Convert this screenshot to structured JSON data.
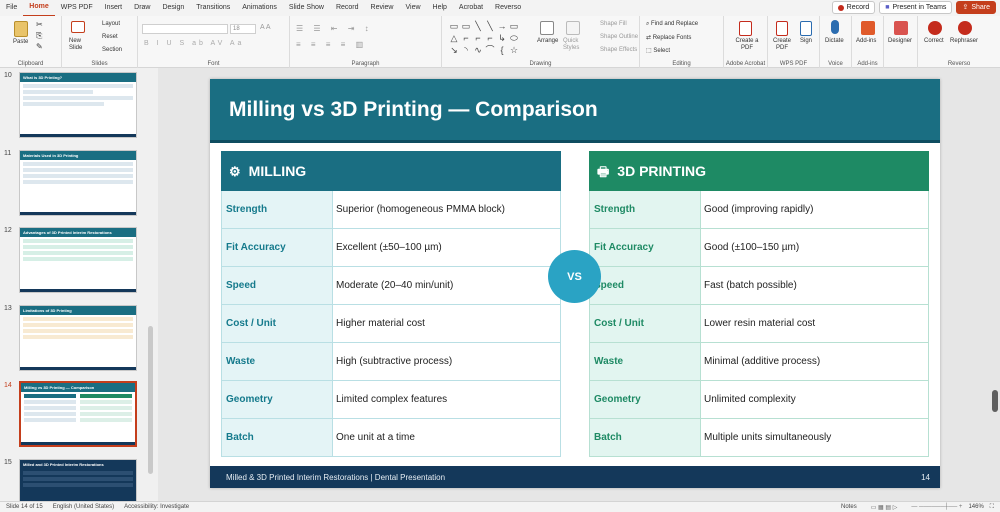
{
  "menubar": {
    "items": [
      "File",
      "Home",
      "WPS PDF",
      "Insert",
      "Draw",
      "Design",
      "Transitions",
      "Animations",
      "Slide Show",
      "Record",
      "Review",
      "View",
      "Help",
      "Acrobat",
      "Reverso"
    ],
    "active": "Home",
    "record_label": "Record",
    "present_label": "Present in Teams",
    "share_label": "Share"
  },
  "ribbon": {
    "paste": "Paste",
    "new_slide": "New Slide",
    "layout": "Layout",
    "reset": "Reset",
    "section": "Section",
    "font_size": "18",
    "arrange": "Arrange",
    "quick_styles": "Quick Styles",
    "shape_fill": "Shape Fill",
    "shape_outline": "Shape Outline",
    "shape_effects": "Shape Effects",
    "find_replace": "Find and Replace",
    "replace_fonts": "Replace Fonts",
    "select": "Select",
    "create_pdf": "Create a PDF",
    "create_pdf2": "Create PDF",
    "sign": "Sign",
    "dictate": "Dictate",
    "addins": "Add-ins",
    "designer": "Designer",
    "correct": "Correct",
    "rephraser": "Rephraser",
    "groups": {
      "clipboard": "Clipboard",
      "slides": "Slides",
      "font": "Font",
      "paragraph": "Paragraph",
      "drawing": "Drawing",
      "editing": "Editing",
      "adobe": "Adobe Acrobat",
      "wpspdf": "WPS PDF",
      "voice": "Voice",
      "addins": "Add-ins",
      "reverso": "Reverso"
    }
  },
  "thumbnails": [
    {
      "num": "10",
      "title": "What is 3D Printing?"
    },
    {
      "num": "11",
      "title": "Materials Used in 3D Printing"
    },
    {
      "num": "12",
      "title": "Advantages of 3D Printed Interim Restorations"
    },
    {
      "num": "13",
      "title": "Limitations of 3D Printing"
    },
    {
      "num": "14",
      "title": "Milling vs 3D Printing — Comparison"
    },
    {
      "num": "15",
      "title": "Milled and 3D Printed Interim Restorations"
    }
  ],
  "slide": {
    "title": "Milling vs 3D Printing — Comparison",
    "vs_label": "VS",
    "footer_left": "Milled & 3D Printed Interim Restorations  |  Dental Presentation",
    "page_number": "14",
    "milling": {
      "heading": "MILLING",
      "rows": [
        {
          "label": "Strength",
          "value": "Superior (homogeneous PMMA block)"
        },
        {
          "label": "Fit Accuracy",
          "value": "Excellent (±50–100 µm)"
        },
        {
          "label": "Speed",
          "value": "Moderate (20–40 min/unit)"
        },
        {
          "label": "Cost / Unit",
          "value": "Higher material cost"
        },
        {
          "label": "Waste",
          "value": "High (subtractive process)"
        },
        {
          "label": "Geometry",
          "value": "Limited complex features"
        },
        {
          "label": "Batch",
          "value": "One unit at a time"
        }
      ]
    },
    "printing": {
      "heading": "3D PRINTING",
      "rows": [
        {
          "label": "Strength",
          "value": "Good (improving rapidly)"
        },
        {
          "label": "Fit Accuracy",
          "value": "Good (±100–150 µm)"
        },
        {
          "label": "Speed",
          "value": "Fast (batch possible)"
        },
        {
          "label": "Cost / Unit",
          "value": "Lower resin material cost"
        },
        {
          "label": "Waste",
          "value": "Minimal (additive process)"
        },
        {
          "label": "Geometry",
          "value": "Unlimited complexity"
        },
        {
          "label": "Batch",
          "value": "Multiple units simultaneously"
        }
      ]
    }
  },
  "status": {
    "slide_info": "Slide 14 of 15",
    "language": "English (United States)",
    "accessibility": "Accessibility: Investigate",
    "notes": "Notes",
    "zoom": "146%"
  }
}
